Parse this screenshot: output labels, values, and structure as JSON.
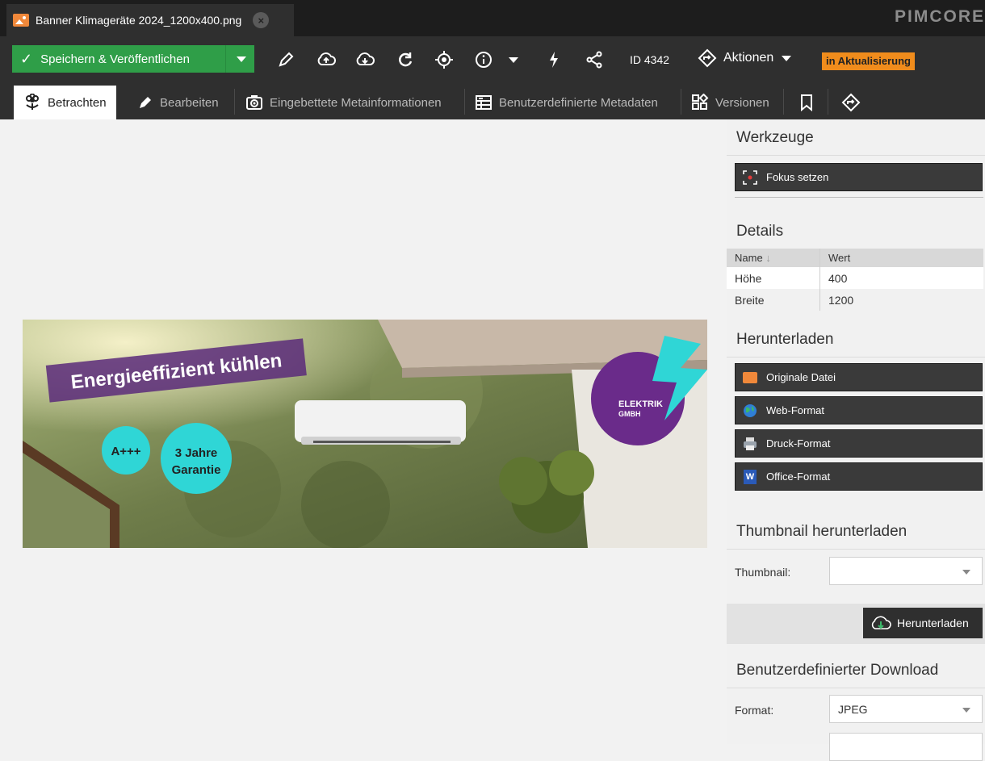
{
  "tab": {
    "title": "Banner Klimageräte 2024_1200x400.png",
    "close_symbol": "×"
  },
  "logo": "PIMCORE",
  "toolbar": {
    "save_label": "Speichern & Veröffentlichen",
    "id_label": "ID 4342",
    "actions_label": "Aktionen",
    "status_label": "in Aktualisierung"
  },
  "subtabs": [
    {
      "label": "Betrachten",
      "icon": "flower-icon",
      "active": true
    },
    {
      "label": "Bearbeiten",
      "icon": "pencil-icon",
      "active": false
    },
    {
      "label": "Eingebettete Metainformationen",
      "icon": "camera-icon",
      "active": false
    },
    {
      "label": "Benutzerdefinierte Metadaten",
      "icon": "form-icon",
      "active": false
    },
    {
      "label": "Versionen",
      "icon": "versions-icon",
      "active": false
    }
  ],
  "banner": {
    "headline": "Energieeffizient kühlen",
    "badge_1": "A+++",
    "badge_2_line1": "3 Jahre",
    "badge_2_line2": "Garantie",
    "brand_line1": "ELEKTRIK",
    "brand_line2": "GMBH"
  },
  "sidebar": {
    "tools_title": "Werkzeuge",
    "focus_button": "Fokus setzen",
    "details_title": "Details",
    "details_headers": {
      "name": "Name",
      "value": "Wert"
    },
    "details_rows": [
      {
        "name": "Höhe",
        "value": "400"
      },
      {
        "name": "Breite",
        "value": "1200"
      }
    ],
    "download_title": "Herunterladen",
    "download_buttons": [
      "Originale Datei",
      "Web-Format",
      "Druck-Format",
      "Office-Format"
    ],
    "thumbnail_title": "Thumbnail herunterladen",
    "thumbnail_label": "Thumbnail:",
    "thumbnail_value": "",
    "download_button": "Herunterladen",
    "custom_title": "Benutzerdefinierter Download",
    "format_label": "Format:",
    "format_value": "JPEG"
  },
  "colors": {
    "save_green": "#2f9e48",
    "status_orange": "#f08c1c",
    "dark_bg": "#2f2f2f",
    "banner_purple": "#6a2b8a",
    "banner_cyan": "#2fd6d6"
  }
}
